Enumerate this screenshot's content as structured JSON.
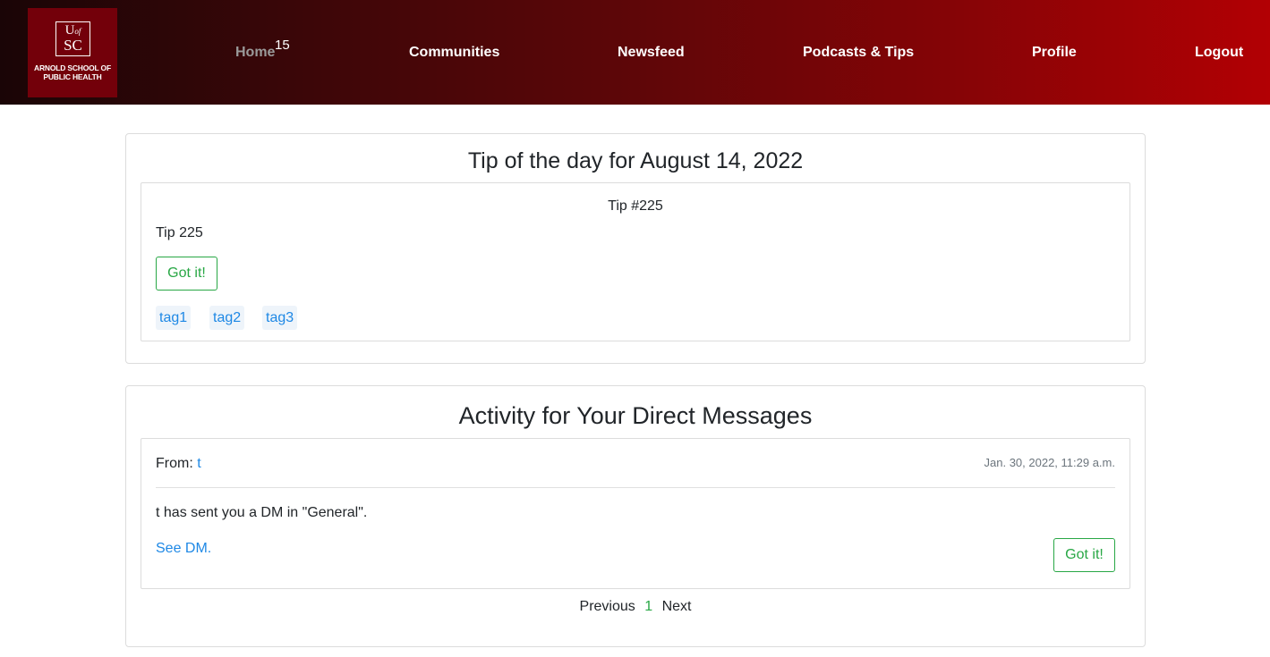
{
  "header": {
    "logo": {
      "u": "U",
      "of": "of",
      "sc": "SC",
      "line1": "ARNOLD SCHOOL OF",
      "line2": "PUBLIC HEALTH"
    },
    "nav": {
      "home": "Home",
      "home_badge": "15",
      "communities": "Communities",
      "newsfeed": "Newsfeed",
      "podcasts": "Podcasts & Tips",
      "profile": "Profile",
      "logout": "Logout"
    },
    "colors": {
      "gradient_start": "#1a0506",
      "gradient_end": "#b20004",
      "logo_bg": "#73000a"
    }
  },
  "tip_card": {
    "title": "Tip of the day for August 14, 2022",
    "tip_number": "Tip #225",
    "tip_body": "Tip 225",
    "got_it": "Got it!",
    "tags": [
      "tag1",
      "tag2",
      "tag3"
    ]
  },
  "dm_card": {
    "title": "Activity for Your Direct Messages",
    "from_label": "From:",
    "from_user": "t",
    "timestamp": "Jan. 30, 2022, 11:29 a.m.",
    "message": "t has sent you a DM in \"General\".",
    "see_link": "See DM.",
    "got_it": "Got it!",
    "pagination": {
      "previous": "Previous",
      "current": "1",
      "next": "Next"
    }
  }
}
